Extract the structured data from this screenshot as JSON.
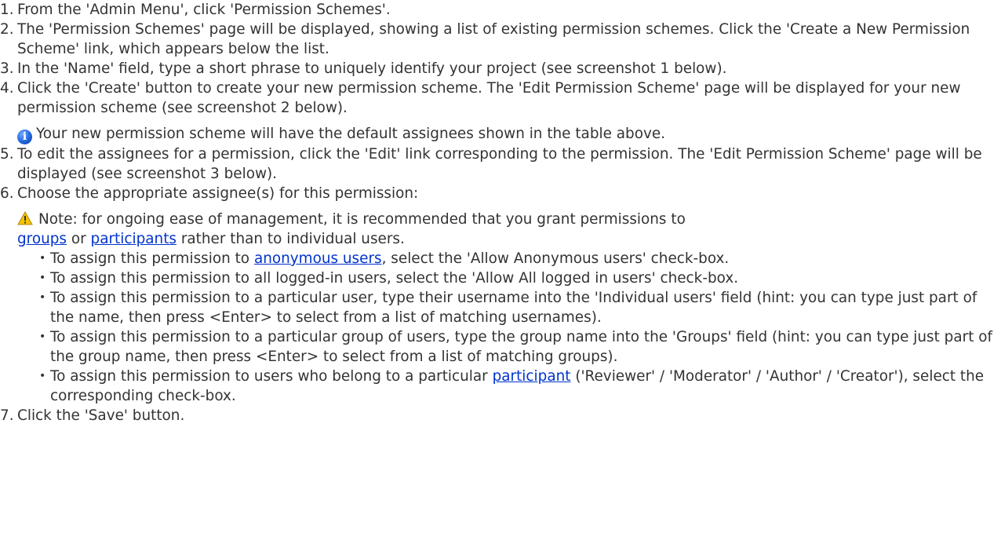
{
  "steps": [
    {
      "num": "1.",
      "text": "From the 'Admin Menu', click 'Permission Schemes'."
    },
    {
      "num": "2.",
      "text": "The 'Permission Schemes' page will be displayed, showing a list of existing permission schemes. Click the 'Create a New Permission Scheme' link, which appears below the list."
    },
    {
      "num": "3.",
      "text": "In the 'Name' field, type a short phrase to uniquely identify your project (see screenshot 1 below)."
    },
    {
      "num": "4.",
      "text": "Click the 'Create' button to create your new permission scheme. The 'Edit Permission Scheme' page will be displayed for your new permission scheme (see screenshot 2 below)."
    },
    {
      "num": "5.",
      "text": "To edit the assignees for a permission, click the 'Edit' link corresponding to the permission. The 'Edit Permission Scheme' page will be displayed (see screenshot 3 below)."
    },
    {
      "num": "6.",
      "text": "Choose the appropriate assignee(s) for this permission:"
    },
    {
      "num": "7.",
      "text": "Click the 'Save' button."
    }
  ],
  "info_note": {
    "icon": "info-icon",
    "icon_glyph": "i",
    "text": "Your new permission scheme will have the default assignees shown in the table above."
  },
  "warning_note": {
    "icon": "warning-icon",
    "pre": "Note: for ongoing ease of management, it is recommended that you grant permissions to",
    "link1": "groups",
    "mid": "or",
    "link2": "participants",
    "post": "rather than to individual users."
  },
  "bullets": {
    "glyph": "•",
    "b1": {
      "pre": "To assign this permission to",
      "link": "anonymous users",
      "post": ", select the 'Allow Anonymous users' check-box."
    },
    "b2": {
      "text": "To assign this permission to all logged-in users, select the 'Allow All logged in users' check-box."
    },
    "b3": {
      "text": "To assign this permission to a particular user, type their username into the 'Individual users' field (hint: you can type just part of the name, then press <Enter> to select from a list of matching usernames)."
    },
    "b4": {
      "text": "To assign this permission to a particular group of users, type the group name into the 'Groups' field (hint: you can type just part of the group name, then press <Enter> to select from a list of matching groups)."
    },
    "b5": {
      "pre": "To assign this permission to users who belong to a particular",
      "link": "participant",
      "post": "('Reviewer' / 'Moderator' / 'Author' / 'Creator'), select the corresponding check-box."
    }
  },
  "colors": {
    "text": "#333333",
    "link": "#0033cc",
    "info_blue": "#1d5fd6",
    "warning_yellow": "#f5c400"
  }
}
